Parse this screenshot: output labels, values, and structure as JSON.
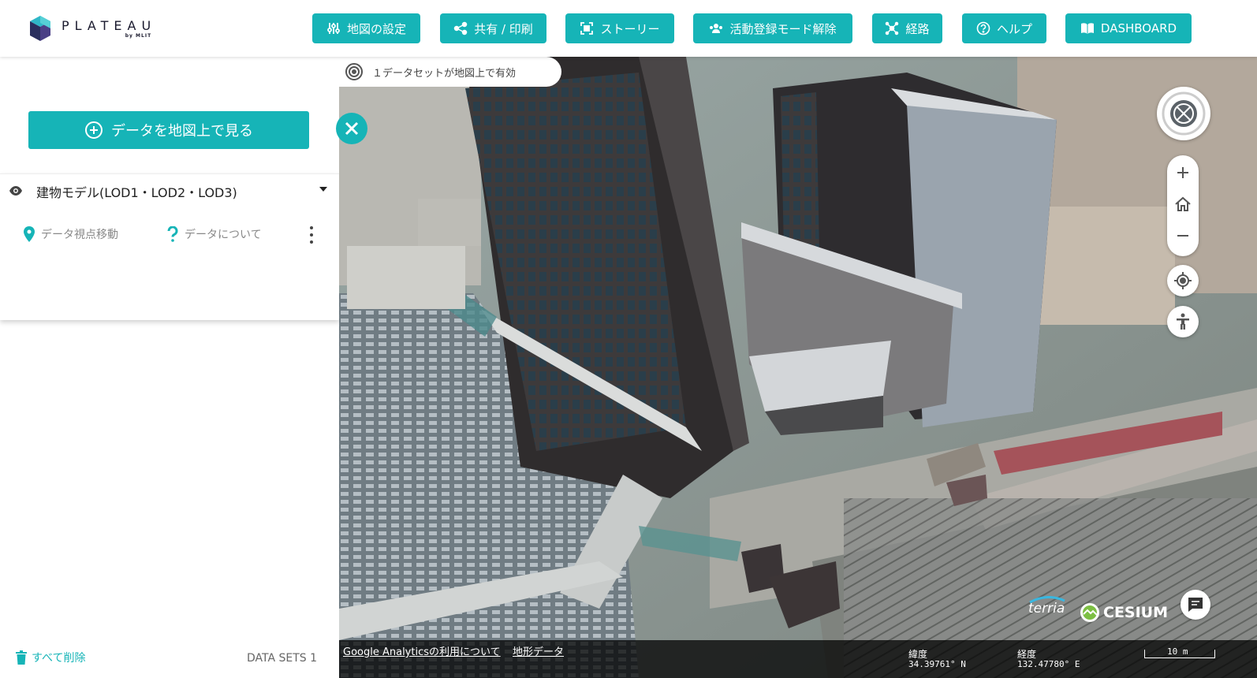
{
  "header": {
    "logo_text": "PLATEAU",
    "logo_sub": "by MLIT",
    "buttons": {
      "map_settings": "地図の設定",
      "share_print": "共有 / 印刷",
      "story": "ストーリー",
      "activity_mode": "活動登録モード解除",
      "route": "経路",
      "help": "ヘルプ",
      "dashboard": "DASHBOARD"
    }
  },
  "panel": {
    "add_data_label": "データを地図上で見る",
    "workbench_item": {
      "title": "建物モデル(LOD1・LOD2・LOD3)",
      "action_zoom": "データ視点移動",
      "action_about": "データについて"
    },
    "delete_all_label": "すべて削除",
    "datasets_count": "DATA SETS 1"
  },
  "map": {
    "active_datasets_text": "１データセットが地図上で有効",
    "brands": {
      "terria": "terria",
      "cesium": "CESIUM"
    },
    "bottom": {
      "ga_link": "Google Analyticsの利用について",
      "terrain_link": "地形データ",
      "lat_label": "緯度",
      "lat_value": "34.39761° N",
      "lon_label": "経度",
      "lon_value": "132.47780° E",
      "scale_label": "10 m"
    }
  },
  "colors": {
    "accent": "#16b4b7"
  }
}
